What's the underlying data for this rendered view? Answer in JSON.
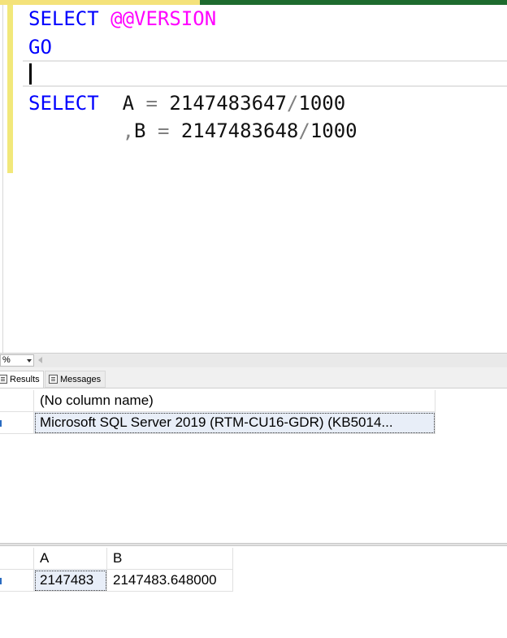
{
  "editor": {
    "line1": {
      "keyword": "SELECT",
      "var": "@@VERSION"
    },
    "line2": {
      "keyword": "GO"
    },
    "line4": {
      "keyword": "SELECT",
      "col": "A",
      "eq": "=",
      "num": "2147483647",
      "op": "/",
      "div": "1000"
    },
    "line5": {
      "comma": ",",
      "col": "B",
      "eq": "=",
      "num": "2147483648",
      "op": "/",
      "div": "1000"
    }
  },
  "zoom": {
    "value": "%"
  },
  "tabs": {
    "results_label": "Results",
    "messages_label": "Messages"
  },
  "grid1": {
    "header": "(No column name)",
    "row1": "Microsoft SQL Server 2019 (RTM-CU16-GDR) (KB5014..."
  },
  "grid2": {
    "headers": [
      "A",
      "B"
    ],
    "row1": [
      "2147483",
      "2147483.648000"
    ]
  },
  "colors": {
    "keyword": "#0000ff",
    "system_var": "#ff00ff",
    "change_bar": "#f2e87a",
    "selection": "#e8eef8"
  }
}
